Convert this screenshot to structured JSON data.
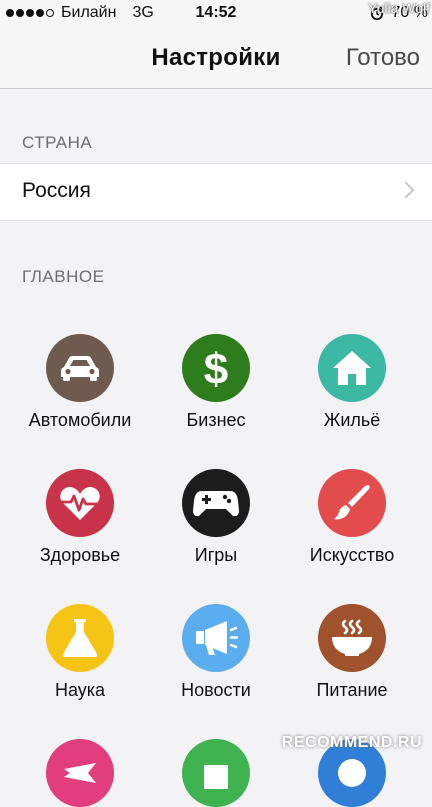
{
  "status_bar": {
    "carrier": "Билайн",
    "network": "3G",
    "time": "14:52",
    "battery": "70 %",
    "watermark": "Yulia Wolf"
  },
  "nav": {
    "title": "Настройки",
    "done_label": "Готово"
  },
  "country_section": {
    "header": "СТРАНА",
    "value": "Россия"
  },
  "main_section": {
    "header": "ГЛАВНОЕ",
    "categories": [
      {
        "label": "Автомобили",
        "icon": "car-icon",
        "color": "#6e5a4e"
      },
      {
        "label": "Бизнес",
        "icon": "dollar-icon",
        "color": "#2e7d1d"
      },
      {
        "label": "Жильё",
        "icon": "house-icon",
        "color": "#3cb9a2"
      },
      {
        "label": "Здоровье",
        "icon": "heart-pulse-icon",
        "color": "#c9334a"
      },
      {
        "label": "Игры",
        "icon": "gamepad-icon",
        "color": "#1c1c1c"
      },
      {
        "label": "Искусство",
        "icon": "paintbrush-icon",
        "color": "#e34c4c"
      },
      {
        "label": "Наука",
        "icon": "flask-icon",
        "color": "#f5c414"
      },
      {
        "label": "Новости",
        "icon": "megaphone-icon",
        "color": "#5aaef0"
      },
      {
        "label": "Питание",
        "icon": "soup-bowl-icon",
        "color": "#a0522d"
      }
    ],
    "partial_row_colors": [
      "#e23e7e",
      "#3fb34f",
      "#2f7fd6"
    ]
  },
  "bottom_watermark": "RECOMMEND.RU"
}
